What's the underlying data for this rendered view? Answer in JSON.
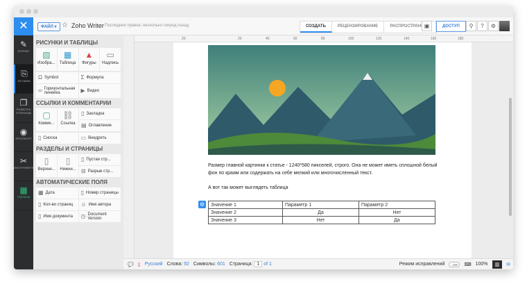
{
  "header": {
    "close_icon": "close-icon",
    "file_label": "ФАЙЛ ▾",
    "app_title": "Zoho Writer",
    "last_edit": "Последняя правка: несколько секунд назад",
    "tabs": [
      "СОЗДАТЬ",
      "РЕЦЕНЗИРОВАНИЕ",
      "РАСПРОСТРАНИТЬ"
    ],
    "share_label": "ДОСТУП"
  },
  "rail": [
    {
      "label": "ФОРМАТ",
      "icon": "brush-icon"
    },
    {
      "label": "ВСТАВКА",
      "icon": "insert-icon"
    },
    {
      "label": "РАЗМЕТКА СТРАНИЦЫ",
      "icon": "layout-icon"
    },
    {
      "label": "ПРОСМОТР",
      "icon": "eye-icon"
    },
    {
      "label": "ИНСТРУМЕНТЫ",
      "icon": "tools-icon"
    },
    {
      "label": "ТАБЛИЦА",
      "icon": "table-icon"
    }
  ],
  "panel": {
    "s1": {
      "title": "РИСУНКИ И ТАБЛИЦЫ",
      "big": [
        "Изобра...",
        "Таблица",
        "Фигуры",
        "Надпись"
      ],
      "small": [
        "Symbol",
        "Формула",
        "Горизонтальная линейка",
        "Видео"
      ]
    },
    "s2": {
      "title": "ССЫЛКИ И КОММЕНТАРИИ",
      "big": [
        "Комме...",
        "Ссылка"
      ],
      "small": [
        "Закладка",
        "Оглавление",
        "Сноска",
        "Внедрить"
      ]
    },
    "s3": {
      "title": "РАЗДЕЛЫ И СТРАНИЦЫ",
      "big": [
        "Верхни...",
        "Нижни..."
      ],
      "small": [
        "Пустая стр...",
        "Разрыв стр..."
      ]
    },
    "s4": {
      "title": "АВТОМАТИЧЕСКИЕ ПОЛЯ",
      "small": [
        "Дата",
        "Номер страницы",
        "Кол-во страниц",
        "Имя автора",
        "Имя документа",
        "Document Version"
      ]
    }
  },
  "ruler": [
    "20",
    "20",
    "40",
    "60",
    "80",
    "100",
    "120",
    "140",
    "160",
    "180"
  ],
  "document": {
    "para1": "Размер главной картинки к статье - 1240*580 пикселей, строго. Она не может иметь сплошной белый фон по краям или содержать на себе мелкий или многочисленный текст.",
    "para2": "А вот так может выглядеть таблица",
    "table": [
      [
        "Значение 1",
        "Параметр 1",
        "Параметр 2"
      ],
      [
        "Значение 2",
        "Да",
        "Нет"
      ],
      [
        "Значение 3",
        "Нет",
        "Да"
      ]
    ]
  },
  "status": {
    "language": "Русский",
    "words_label": "Слова:",
    "words": "92",
    "chars_label": "Символы:",
    "chars": "601",
    "page_label": "Страница:",
    "page": "1",
    "of": "of 1",
    "track_label": "Режим исправлений",
    "track_state": "OFF",
    "zoom": "100%"
  }
}
